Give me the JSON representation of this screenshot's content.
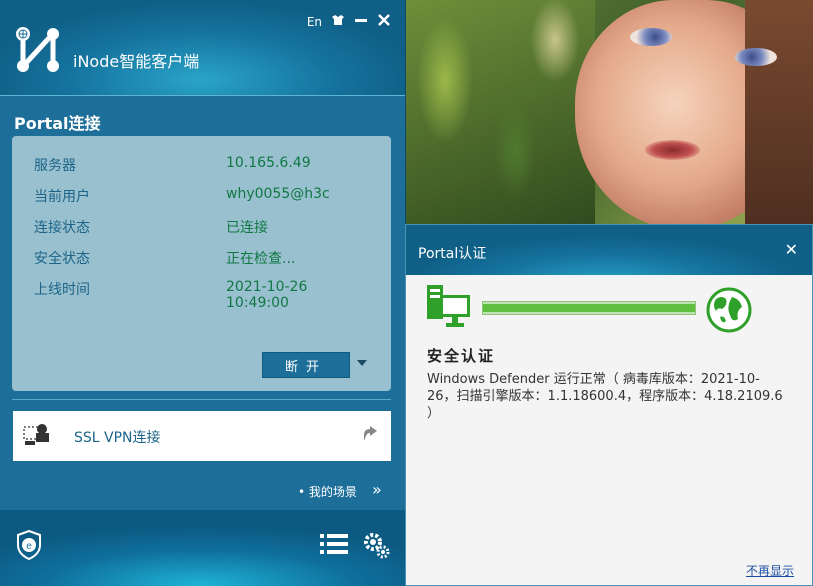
{
  "inode": {
    "app_title": "iNode智能客户端",
    "lang_label": "En",
    "section_title": "Portal连接",
    "info": [
      {
        "key": "服务器",
        "value": "10.165.6.49"
      },
      {
        "key": "当前用户",
        "value": "why0055@h3c"
      },
      {
        "key": "连接状态",
        "value": "已连接"
      },
      {
        "key": "安全状态",
        "value": "正在检查..."
      },
      {
        "key": "上线时间",
        "value": "2021-10-26 10:49:00"
      }
    ],
    "disconnect_label": "断开",
    "vpn_label": "SSL VPN连接",
    "scene_label": "• 我的场景",
    "scene_arrow": "»"
  },
  "portal": {
    "title": "Portal认证",
    "close": "✕",
    "progress": 1.0,
    "security_title": "安全认证",
    "security_message": "Windows Defender 运行正常（ 病毒库版本：2021-10-26，扫描引擎版本：1.1.18600.4，程序版本：4.18.2109.6 ）",
    "no_more_label": "不再显示"
  },
  "colors": {
    "accent": "#1d6f9a",
    "value_green": "#117744",
    "key_blue": "#1d6488",
    "panel_bg": "#99c0cf"
  }
}
